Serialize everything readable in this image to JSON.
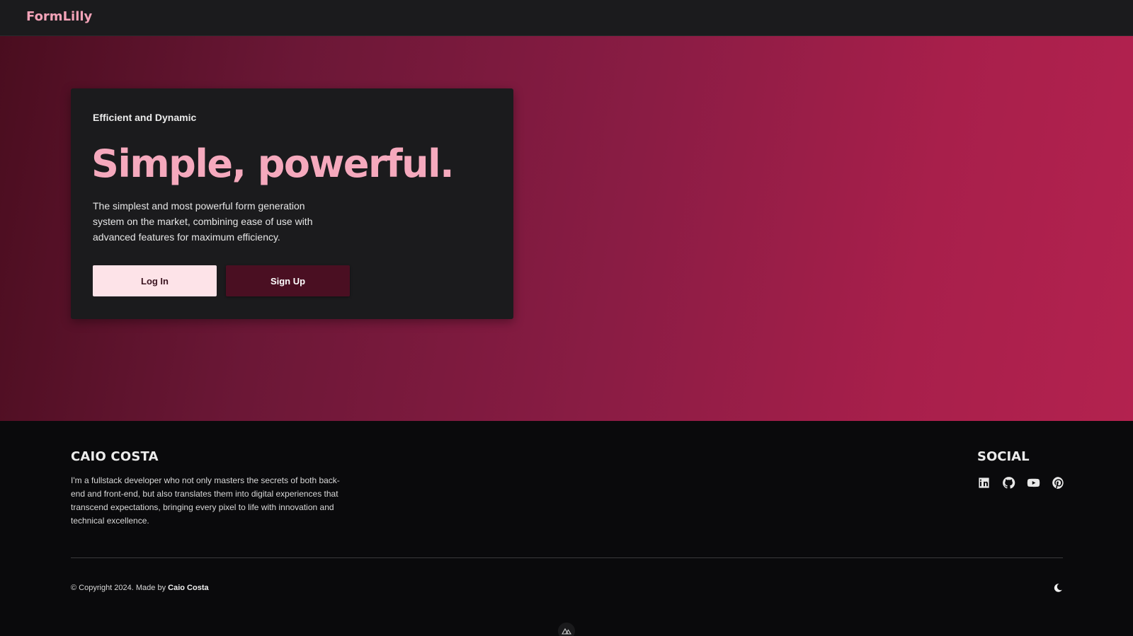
{
  "navbar": {
    "brand": "FormLilly"
  },
  "hero": {
    "eyebrow": "Efficient and Dynamic",
    "headline": "Simple, powerful.",
    "lead": "The simplest and most powerful form generation system on the market, combining ease of use with advanced features for maximum efficiency.",
    "login_label": "Log In",
    "signup_label": "Sign Up"
  },
  "footer": {
    "author_name": "CAIO COSTA",
    "author_bio": "I'm a fullstack developer who not only masters the secrets of both back-end and front-end, but also translates them into digital experiences that transcend expectations, bringing every pixel to life with innovation and technical excellence.",
    "social_title": "SOCIAL",
    "social_icons": [
      "linkedin-icon",
      "github-icon",
      "youtube-icon",
      "pinterest-icon"
    ],
    "copyright_prefix": "© Copyright 2024. Made by",
    "copyright_author": "Caio Costa",
    "theme_icon": "moon-icon"
  },
  "colors": {
    "brand": "#f3a3b8",
    "headline": "#f5a9bd",
    "login_bg": "#fde3e8",
    "signup_bg": "#4a0f22",
    "hero_gradient_start": "#4a0d1f",
    "hero_gradient_end": "#b3224f"
  }
}
